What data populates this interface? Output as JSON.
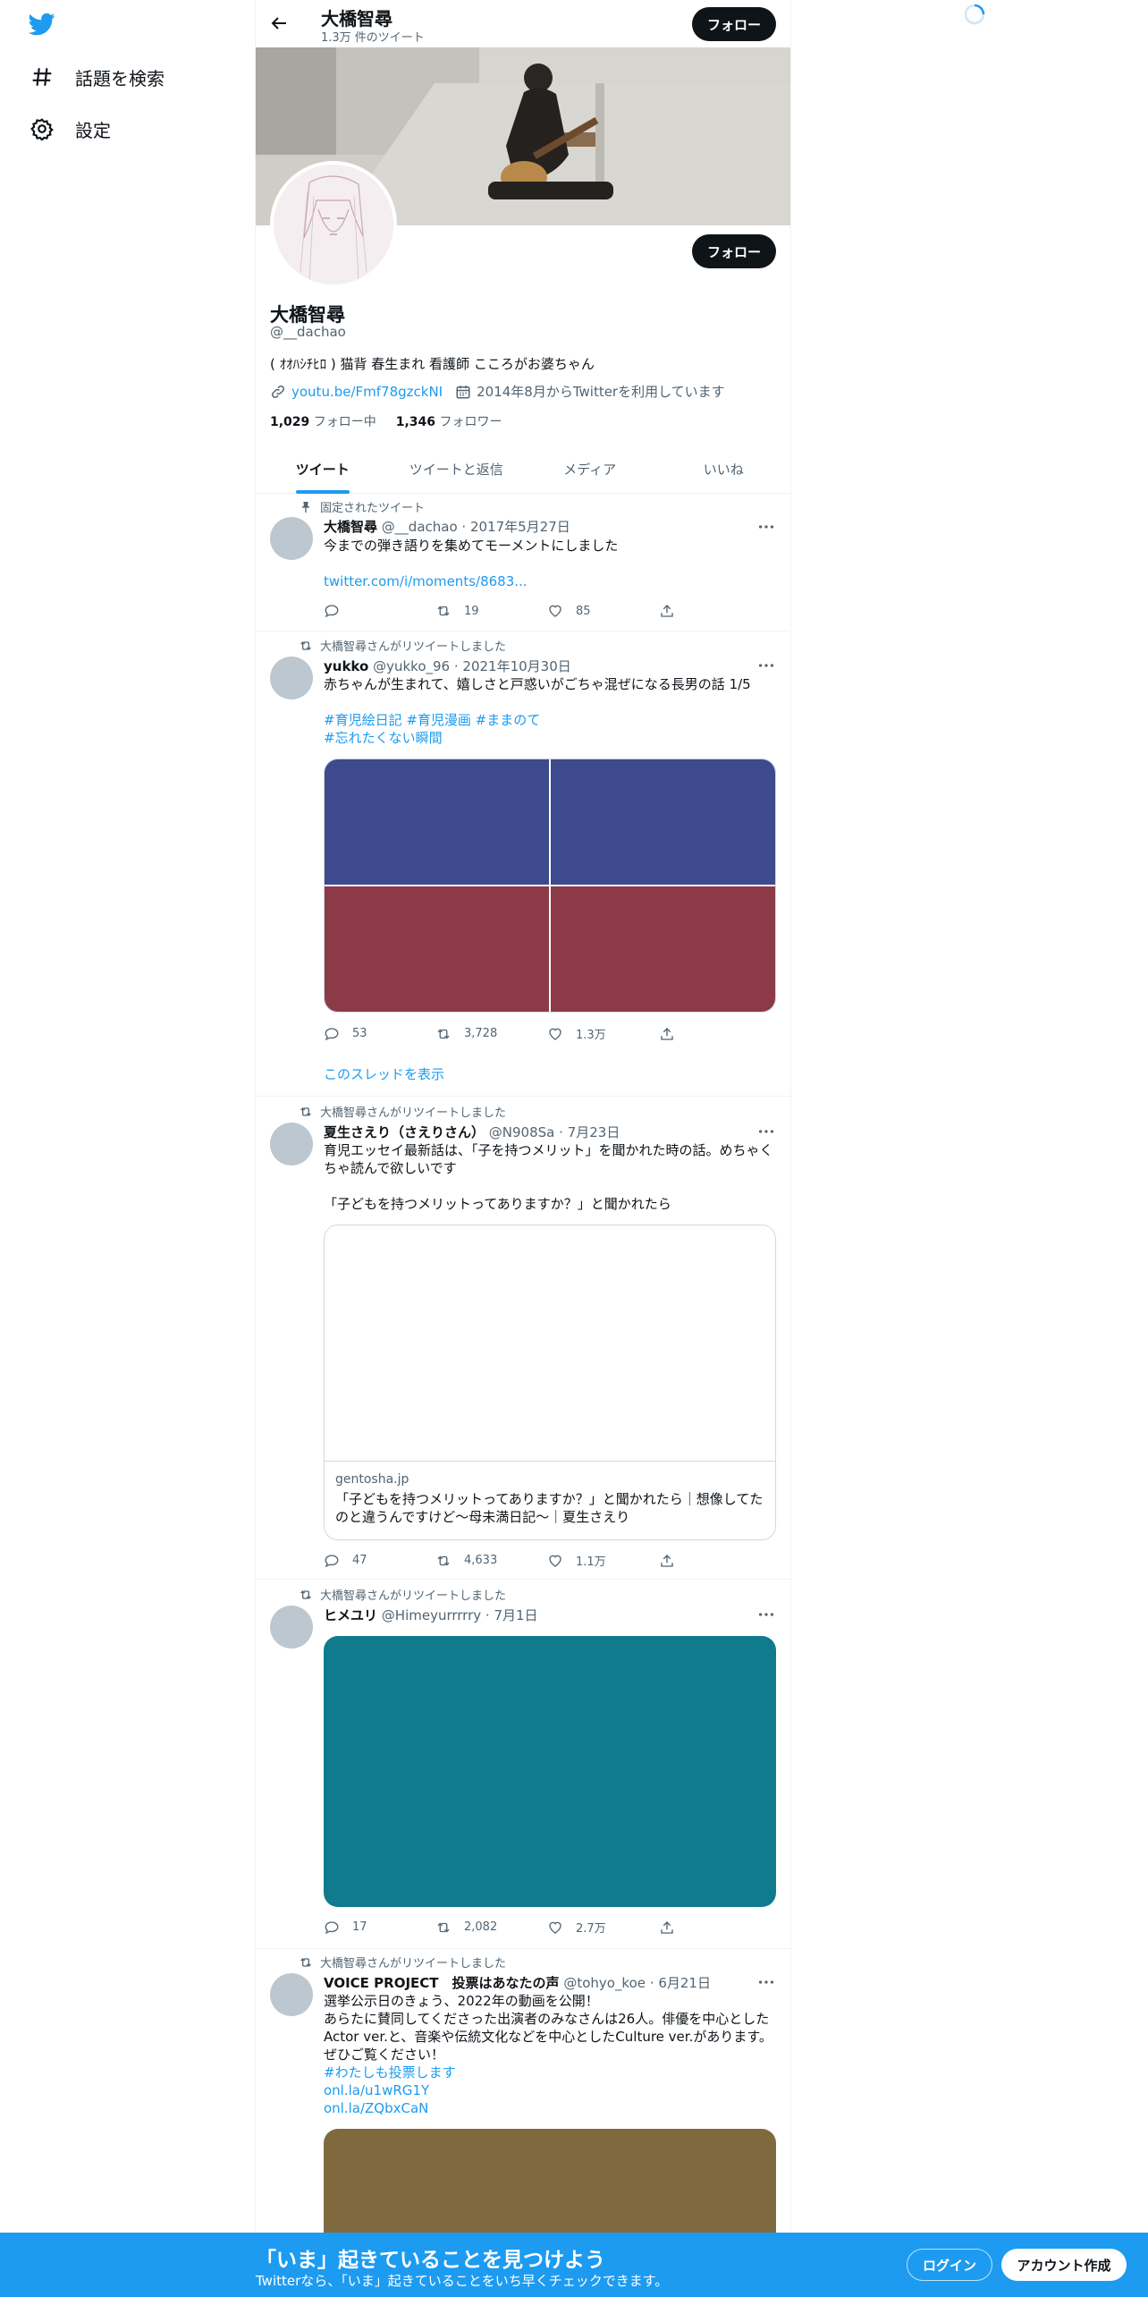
{
  "sidebar": {
    "logo": "twitter-bird-icon",
    "items": [
      {
        "label": "話題を検索",
        "icon": "hashtag-icon"
      },
      {
        "label": "設定",
        "icon": "gear-icon"
      }
    ]
  },
  "header": {
    "name": "大橋智尋",
    "tweet_count": "1.3万 件のツイート",
    "follow_label": "フォロー"
  },
  "profile": {
    "name": "大橋智尋",
    "handle": "@__dachao",
    "bio": "( ｵｵﾊｼﾁﾋﾛ ) 猫背 春生まれ 看護師 こころがお婆ちゃん",
    "link": "youtu.be/Fmf78gzckNI",
    "joined": "2014年8月からTwitterを利用しています",
    "following_count": "1,029",
    "following_label": "フォロー中",
    "followers_count": "1,346",
    "followers_label": "フォロワー",
    "follow_label": "フォロー"
  },
  "tabs": [
    "ツイート",
    "ツイートと返信",
    "メディア",
    "いいね"
  ],
  "tweets": [
    {
      "context": "固定されたツイート",
      "name": "大橋智尋",
      "handle": "@__dachao",
      "date": "2017年5月27日",
      "text": "今までの弾き語りを集めてモーメントにしました",
      "link": "twitter.com/i/moments/8683...",
      "replies": "",
      "retweets": "19",
      "likes": "85"
    },
    {
      "context": "大橋智尋さんがリツイートしました",
      "name": "yukko",
      "handle": "@yukko_96",
      "date": "2021年10月30日",
      "text": "赤ちゃんが生まれて、嬉しさと戸惑いがごちゃ混ぜになる長男の話 1/5",
      "hashtags1": "#育児絵日記 #育児漫画 #ままのて",
      "hashtags2": "#忘れたくない瞬間",
      "replies": "53",
      "retweets": "3,728",
      "likes": "1.3万",
      "thread_link": "このスレッドを表示"
    },
    {
      "context": "大橋智尋さんがリツイートしました",
      "name": "夏生さえり（さえりさん）",
      "handle": "@N908Sa",
      "date": "7月23日",
      "text1": "育児エッセイ最新話は、「子を持つメリット」を聞かれた時の話。めちゃくちゃ読んで欲しいです",
      "text2": "「子どもを持つメリットってありますか？」と聞かれたら",
      "card_domain": "gentosha.jp",
      "card_title": "「子どもを持つメリットってありますか？」と聞かれたら｜想像してたのと違うんですけど～母未満日記～｜夏生さえり",
      "replies": "47",
      "retweets": "4,633",
      "likes": "1.1万"
    },
    {
      "context": "大橋智尋さんがリツイートしました",
      "name": "ヒメユリ",
      "handle": "@Himeyurrrrry",
      "date": "7月1日",
      "replies": "17",
      "retweets": "2,082",
      "likes": "2.7万"
    },
    {
      "context": "大橋智尋さんがリツイートしました",
      "name": "VOICE PROJECT　投票はあなたの声",
      "handle": "@tohyo_koe",
      "date": "6月21日",
      "text": "選挙公示日のきょう、2022年の動画を公開！\nあらたに賛同してくださった出演者のみなさんは26人。俳優を中心としたActor ver.と、音楽や伝統文化などを中心としたCulture ver.があります。ぜひご覧ください！",
      "hashtag": "#わたしも投票します",
      "link1": "onl.la/u1wRG1Y",
      "link2": "onl.la/ZQbxCaN"
    }
  ],
  "bottom_bar": {
    "title": "「いま」起きていることを見つけよう",
    "subtitle": "Twitterなら、「いま」起きていることをいち早くチェックできます。",
    "login": "ログイン",
    "signup": "アカウント作成"
  },
  "colors": {
    "accent": "#1d9bf0",
    "media_blue": "#3d4a8e",
    "media_red": "#8c3a48",
    "media_teal": "#0f7b8d",
    "media_brown": "#7f6a40"
  }
}
